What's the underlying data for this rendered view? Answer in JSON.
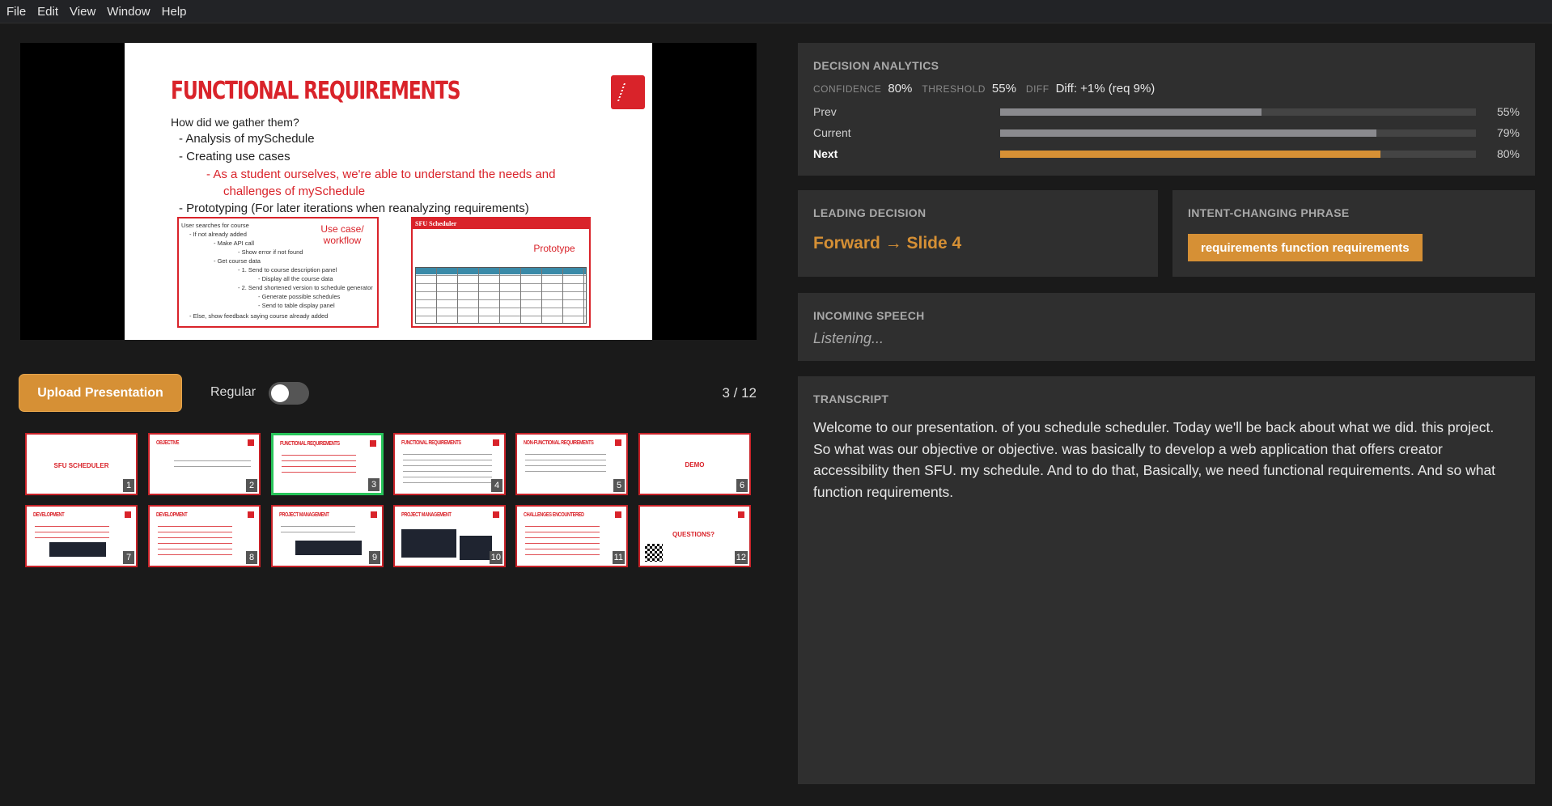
{
  "menu": [
    "File",
    "Edit",
    "View",
    "Window",
    "Help"
  ],
  "slide": {
    "title": "FUNCTIONAL REQUIREMENTS",
    "lines": [
      "How did we gather them?",
      "-   Analysis of mySchedule",
      "-   Creating use cases",
      "-   As a student ourselves, we're able to understand the needs and",
      "challenges of mySchedule",
      "-   Prototyping (For later iterations when reanalyzing requirements)"
    ],
    "usecase_label": "Use case/\nworkflow",
    "usecase_lines": [
      "User searches for course",
      "-  If not already added",
      "-  Make API call",
      "-  Show error if not found",
      "-  Get course data",
      "-  1. Send to course description panel",
      "-  Display all the course data",
      "-  2. Send shortened version to schedule generator",
      "-  Generate possible schedules",
      "-  Send to table display panel",
      "-  Else, show feedback saying course already added"
    ],
    "prototype_header": "SFU Scheduler",
    "prototype_label": "Prototype"
  },
  "controls": {
    "upload_label": "Upload Presentation",
    "mode_label": "Regular",
    "toggle_on": false,
    "counter": "3 / 12"
  },
  "thumbnails": [
    {
      "num": "1",
      "title": "SFU SCHEDULER",
      "active": false
    },
    {
      "num": "2",
      "title": "OBJECTIVE",
      "active": false
    },
    {
      "num": "3",
      "title": "FUNCTIONAL REQUIREMENTS",
      "active": true
    },
    {
      "num": "4",
      "title": "FUNCTIONAL REQUIREMENTS",
      "active": false
    },
    {
      "num": "5",
      "title": "NON-FUNCTIONAL REQUIREMENTS",
      "active": false
    },
    {
      "num": "6",
      "title": "DEMO",
      "active": false
    },
    {
      "num": "7",
      "title": "DEVELOPMENT",
      "active": false
    },
    {
      "num": "8",
      "title": "DEVELOPMENT",
      "active": false
    },
    {
      "num": "9",
      "title": "PROJECT MANAGEMENT",
      "active": false
    },
    {
      "num": "10",
      "title": "PROJECT MANAGEMENT",
      "active": false
    },
    {
      "num": "11",
      "title": "CHALLENGES ENCOUNTERED",
      "active": false
    },
    {
      "num": "12",
      "title": "QUESTIONS?",
      "active": false
    }
  ],
  "analytics": {
    "title": "DECISION ANALYTICS",
    "confidence_key": "CONFIDENCE",
    "confidence": "80%",
    "threshold_key": "THRESHOLD",
    "threshold": "55%",
    "diff_key": "DIFF",
    "diff": "Diff: +1% (req 9%)",
    "bars": [
      {
        "label": "Prev",
        "pct_text": "55%",
        "fraction": 0.55
      },
      {
        "label": "Current",
        "pct_text": "79%",
        "fraction": 0.79
      },
      {
        "label": "Next",
        "pct_text": "80%",
        "fraction": 0.8
      }
    ]
  },
  "leading": {
    "title": "LEADING DECISION",
    "value": "Forward → Slide 4"
  },
  "intent": {
    "title": "INTENT-CHANGING PHRASE",
    "phrase": "requirements function requirements"
  },
  "incoming": {
    "title": "INCOMING SPEECH",
    "status": "Listening..."
  },
  "transcript": {
    "title": "TRANSCRIPT",
    "text": "Welcome to our presentation. of you schedule scheduler. Today we'll be back about what we did. this project. So what was our objective or objective. was basically to develop a web application that offers creator accessibility then SFU. my schedule. And to do that, Basically, we need functional requirements. And so what function requirements."
  },
  "colors": {
    "accent": "#d69035",
    "slide_red": "#d9232a",
    "active_thumb": "#27c45a",
    "panel": "#2f2f2f"
  }
}
